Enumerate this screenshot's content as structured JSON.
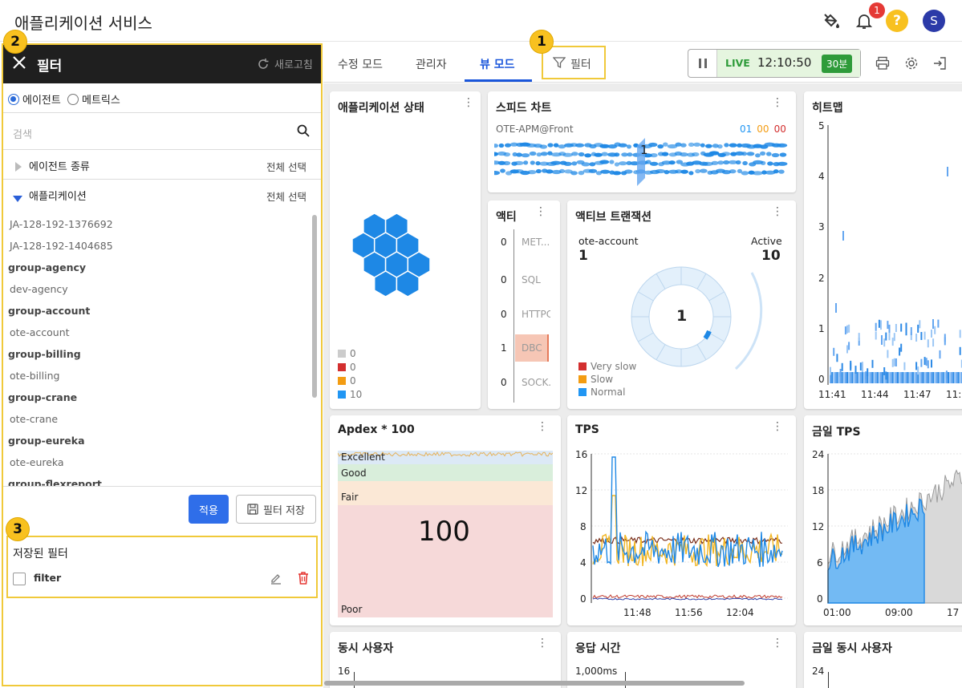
{
  "app": {
    "title": "애플리케이션 서비스",
    "notification_count": "1",
    "help_glyph": "?",
    "avatar_letter": "S"
  },
  "annotations": {
    "badge1": "1",
    "badge2": "2",
    "badge3": "3"
  },
  "filter_panel": {
    "title": "필터",
    "refresh_label": "새로고침",
    "radios": [
      {
        "label": "에이전트",
        "checked": true
      },
      {
        "label": "메트릭스",
        "checked": false
      }
    ],
    "search_placeholder": "검색",
    "agent_type": {
      "label": "에이전트 종류",
      "select_all": "전체 선택"
    },
    "application": {
      "label": "애플리케이션",
      "select_all": "전체 선택"
    },
    "items": [
      {
        "label": "JA-128-192-1376692",
        "group": false
      },
      {
        "label": "JA-128-192-1404685",
        "group": false
      },
      {
        "label": "group-agency",
        "group": true
      },
      {
        "label": "dev-agency",
        "group": false
      },
      {
        "label": "group-account",
        "group": true
      },
      {
        "label": "ote-account",
        "group": false
      },
      {
        "label": "group-billing",
        "group": true
      },
      {
        "label": "ote-billing",
        "group": false
      },
      {
        "label": "group-crane",
        "group": true
      },
      {
        "label": "ote-crane",
        "group": false
      },
      {
        "label": "group-eureka",
        "group": true
      },
      {
        "label": "ote-eureka",
        "group": false
      },
      {
        "label": "group-flexreport",
        "group": true
      }
    ],
    "apply_label": "적용",
    "save_filter_label": "필터 저장",
    "saved_title": "저장된 필터",
    "saved_items": [
      {
        "name": "filter"
      }
    ]
  },
  "tabs": [
    {
      "label": "수정 모드",
      "active": false
    },
    {
      "label": "관리자",
      "active": false
    },
    {
      "label": "뷰 모드",
      "active": true
    }
  ],
  "filter_tab_label": "필터",
  "live": {
    "label": "LIVE",
    "time": "12:10:50",
    "range": "30분"
  },
  "widgets": {
    "app_status": {
      "title": "애플리케이션 상태",
      "legend": [
        {
          "color": "#cccccc",
          "value": "0"
        },
        {
          "color": "#d32f2f",
          "value": "0"
        },
        {
          "color": "#f39c12",
          "value": "0"
        },
        {
          "color": "#2196f3",
          "value": "10"
        }
      ]
    },
    "speed_chart": {
      "title": "스피드 차트",
      "app_name": "OTE-APM@Front",
      "counts": [
        {
          "value": "01",
          "color": "#2196f3"
        },
        {
          "value": "00",
          "color": "#f39c12"
        },
        {
          "value": "00",
          "color": "#d32f2f"
        }
      ],
      "marker": "1"
    },
    "active": {
      "title": "액티",
      "rows": [
        {
          "count": "0",
          "label": "MET..."
        },
        {
          "count": "0",
          "label": "SQL"
        },
        {
          "count": "0",
          "label": "HTTPC"
        },
        {
          "count": "1",
          "label": "DBC"
        },
        {
          "count": "0",
          "label": "SOCK."
        }
      ]
    },
    "active_tx": {
      "title": "액티브 트랜잭션",
      "account": "ote-account",
      "account_value": "1",
      "active_label": "Active",
      "active_value": "10",
      "center_value": "1",
      "legend": [
        {
          "label": "Very slow",
          "color": "#d32f2f"
        },
        {
          "label": "Slow",
          "color": "#f39c12"
        },
        {
          "label": "Normal",
          "color": "#2196f3"
        }
      ]
    },
    "heatmap": {
      "title": "히트맵",
      "y_ticks": [
        "5",
        "4",
        "3",
        "2",
        "1",
        "0"
      ],
      "x_ticks": [
        "11:41",
        "11:44",
        "11:47",
        "11:"
      ]
    },
    "apdex": {
      "title": "Apdex * 100",
      "value": "100",
      "bands": [
        {
          "label": "Excellent",
          "color": "#3b74c7"
        },
        {
          "label": "Good",
          "color": "#3a9a48"
        },
        {
          "label": "Fair",
          "color": "#d79b4a"
        },
        {
          "label": "Poor",
          "color": "#c98080"
        }
      ]
    },
    "tps": {
      "title": "TPS",
      "y_ticks": [
        "16",
        "12",
        "8",
        "4",
        "0"
      ],
      "x_ticks": [
        "11:48",
        "11:56",
        "12:04"
      ]
    },
    "today_tps": {
      "title": "금일 TPS",
      "y_ticks": [
        "24",
        "18",
        "12",
        "6",
        "0"
      ],
      "x_ticks": [
        "01:00",
        "09:00",
        "17"
      ]
    },
    "concurrent_users": {
      "title": "동시 사용자",
      "y_top": "16"
    },
    "response_time": {
      "title": "응답 시간",
      "y_top": "1,000ms"
    },
    "today_concurrent": {
      "title": "금일 동시 사용자",
      "y_top": "24"
    }
  }
}
